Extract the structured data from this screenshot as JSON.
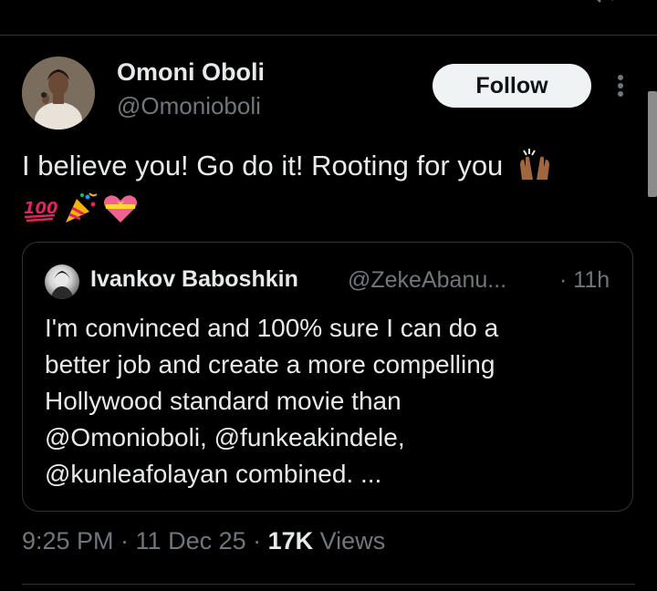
{
  "tweet": {
    "author": {
      "display_name": "Omoni Oboli",
      "handle": "@Omonioboli"
    },
    "follow_label": "Follow",
    "text_line1": "I believe you! Go do it! Rooting for you",
    "emojis": [
      "raising-hands",
      "hundred-points",
      "party-popper",
      "heart-with-ribbon"
    ],
    "timestamp": "9:25 PM · 11 Dec 25 · ",
    "views_count": "17K",
    "views_label": " Views"
  },
  "quoted": {
    "display_name": "Ivankov Baboshkin",
    "handle": "@ZekeAbanu...",
    "time": "· 11h",
    "text_lines": [
      "I'm convinced and 100% sure I can do a",
      "better job and create a more compelling",
      "Hollywood standard movie than",
      "@Omonioboli, @funkeakindele,",
      "@kunleafolayan combined. ..."
    ]
  },
  "colors": {
    "background": "#000000",
    "text_primary": "#e7e9ea",
    "text_secondary": "#71767b",
    "border": "#2f3336",
    "follow_bg": "#eff3f4"
  }
}
